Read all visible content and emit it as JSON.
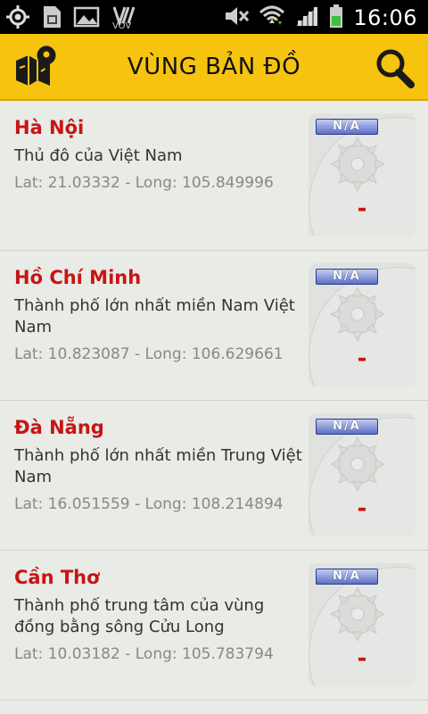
{
  "status_bar": {
    "time": "16:06",
    "icons": [
      "gps-icon",
      "sim-card-icon",
      "gallery-icon",
      "vov-icon",
      "mute-icon",
      "wifi-icon",
      "signal-icon",
      "battery-icon"
    ],
    "vov_label": "VOV"
  },
  "app_bar": {
    "title": "VÙNG BẢN ĐỒ",
    "left_icon": "map-pin-icon",
    "right_icon": "search-icon",
    "background": "#f6c40f"
  },
  "items": [
    {
      "name": "Hà Nội",
      "description": "Thủ đô của Việt Nam",
      "coords": "Lat: 21.03332 - Long: 105.849996",
      "badge": "N/A",
      "value": "-"
    },
    {
      "name": "Hồ Chí Minh",
      "description": "Thành phố lớn nhất miền Nam Việt Nam",
      "coords": "Lat: 10.823087 - Long: 106.629661",
      "badge": "N/A",
      "value": "-"
    },
    {
      "name": "Đà Nẵng",
      "description": "Thành phố lớn nhất miền Trung Việt Nam",
      "coords": "Lat: 16.051559 - Long: 108.214894",
      "badge": "N/A",
      "value": "-"
    },
    {
      "name": "Cần Thơ",
      "description": "Thành phố trung tâm của vùng đồng bằng sông Cửu Long",
      "coords": "Lat: 10.03182 - Long: 105.783794",
      "badge": "N/A",
      "value": "-"
    }
  ],
  "colors": {
    "accent": "#f6c40f",
    "name_red": "#c81414",
    "background": "#e8ebe6"
  }
}
